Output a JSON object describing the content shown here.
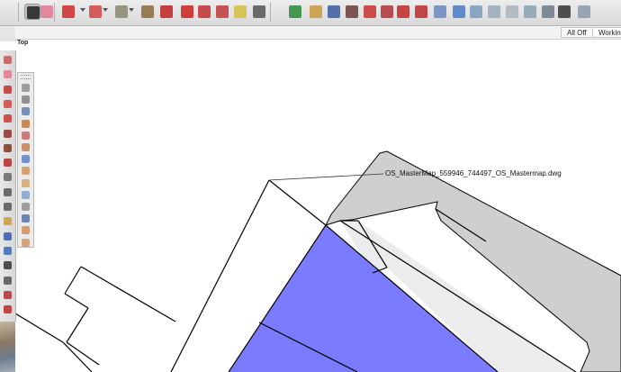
{
  "scene_tabs": [
    {
      "label": "All Off"
    },
    {
      "label": "Working"
    }
  ],
  "viewport": {
    "view_label": "Top",
    "dimension_label": "OS_MasterMap_559946_744497_OS_Mastermap.dwg",
    "colors": {
      "selected_face": "#7b7bff",
      "gray_face": "#cfcfcf",
      "light_face": "#ececec",
      "edge": "#000000"
    }
  },
  "toolbar_tools": [
    {
      "name": "select-tool",
      "icon": "select-arrow-icon",
      "color": "#222222"
    },
    {
      "name": "eraser-tool",
      "icon": "eraser-icon",
      "color": "#e07890"
    },
    {
      "name": "line-tool",
      "icon": "pencil-icon",
      "color": "#cc2a2a"
    },
    {
      "name": "arc-tool",
      "icon": "arc-icon",
      "color": "#d04444"
    },
    {
      "name": "rectangle-tool",
      "icon": "rectangle-icon",
      "color": "#8a8a70"
    },
    {
      "name": "push-pull-tool",
      "icon": "push-pull-icon",
      "color": "#8a6a3a"
    },
    {
      "name": "offset-tool",
      "icon": "offset-icon",
      "color": "#c02020"
    },
    {
      "name": "move-tool",
      "icon": "move-icon",
      "color": "#cc2020"
    },
    {
      "name": "rotate-tool",
      "icon": "rotate-icon",
      "color": "#c03030"
    },
    {
      "name": "scale-tool",
      "icon": "scale-icon",
      "color": "#c03a3a"
    },
    {
      "name": "tape-measure-tool",
      "icon": "tape-measure-icon",
      "color": "#d4c040"
    },
    {
      "name": "text-tool",
      "icon": "text-icon",
      "color": "#555555"
    },
    {
      "name": "orbit-tool",
      "icon": "orbit-icon",
      "color": "#2a8a3a"
    },
    {
      "name": "pan-tool",
      "icon": "pan-hand-icon",
      "color": "#c89a40"
    },
    {
      "name": "zoom-tool",
      "icon": "zoom-magnifier-icon",
      "color": "#3a5aa0"
    },
    {
      "name": "zoom-extents-tool",
      "icon": "zoom-extents-icon",
      "color": "#6a3a3a"
    },
    {
      "name": "components-tool",
      "icon": "components-icon",
      "color": "#c83030"
    },
    {
      "name": "warehouse-tool",
      "icon": "warehouse-icon",
      "color": "#b03030"
    },
    {
      "name": "extension-tool",
      "icon": "extension-icon",
      "color": "#c02828"
    },
    {
      "name": "styles-tool",
      "icon": "styles-icon",
      "color": "#b82a2a"
    },
    {
      "name": "share-tool",
      "icon": "share-icon",
      "color": "#6a8ac0"
    },
    {
      "name": "section-tool",
      "icon": "section-icon",
      "color": "#4a7ac8"
    },
    {
      "name": "style-xray-tool",
      "icon": "xray-cube-icon",
      "color": "#7a9ab8"
    },
    {
      "name": "style-wireframe-tool",
      "icon": "wireframe-cube-icon",
      "color": "#9aaabb"
    },
    {
      "name": "style-hidden-line-tool",
      "icon": "hidden-line-cube-icon",
      "color": "#aab5c0"
    },
    {
      "name": "style-shaded-tool",
      "icon": "shaded-cube-icon",
      "color": "#8aa0b0"
    },
    {
      "name": "style-textured-tool",
      "icon": "textured-cube-icon",
      "color": "#6a7a8a"
    },
    {
      "name": "style-monochrome-tool",
      "icon": "monochrome-cube-icon",
      "color": "#333333"
    },
    {
      "name": "style-extra-tool",
      "icon": "cube-icon",
      "color": "#8a9aaa"
    }
  ],
  "sidebar_tools": [
    {
      "name": "paint-bucket-tool",
      "icon": "paint-bucket-icon",
      "color": "#c05a5a"
    },
    {
      "name": "eraser-tool",
      "icon": "eraser-icon",
      "color": "#e07890"
    },
    {
      "name": "pencil-tool",
      "icon": "pencil-icon",
      "color": "#c03030"
    },
    {
      "name": "arc-tool",
      "icon": "arc-icon",
      "color": "#d04444"
    },
    {
      "name": "freehand-tool",
      "icon": "freehand-icon",
      "color": "#c83838"
    },
    {
      "name": "push-pull-tool",
      "icon": "push-pull-icon",
      "color": "#8a3030"
    },
    {
      "name": "follow-me-tool",
      "icon": "follow-me-icon",
      "color": "#7a3a20"
    },
    {
      "name": "offset-tool",
      "icon": "offset-icon",
      "color": "#b02828"
    },
    {
      "name": "measure-tool",
      "icon": "tape-measure-icon",
      "color": "#666666"
    },
    {
      "name": "text-tool",
      "icon": "text-icon",
      "color": "#555555"
    },
    {
      "name": "paint-tool",
      "icon": "paint-icon",
      "color": "#555555"
    },
    {
      "name": "pan-tool",
      "icon": "pan-hand-icon",
      "color": "#c89a40"
    },
    {
      "name": "zoom-tool",
      "icon": "zoom-magnifier-icon",
      "color": "#3a5aa0"
    },
    {
      "name": "zoom-window-tool",
      "icon": "zoom-window-icon",
      "color": "#3a6ab0"
    },
    {
      "name": "walk-tool",
      "icon": "footprints-icon",
      "color": "#333333"
    },
    {
      "name": "look-around-tool",
      "icon": "eye-icon",
      "color": "#555555"
    },
    {
      "name": "section-plane-tool",
      "icon": "section-plane-icon",
      "color": "#b03030"
    },
    {
      "name": "display-section-tool",
      "icon": "display-section-icon",
      "color": "#c02828"
    }
  ],
  "palette_tools": [
    {
      "name": "dimension-tool",
      "icon": "dimension-icon",
      "color": "#8a8a8a"
    },
    {
      "name": "protractor-tool",
      "icon": "protractor-icon",
      "color": "#7a7a7a"
    },
    {
      "name": "axes-tool",
      "icon": "axes-icon",
      "color": "#5a7ab0"
    },
    {
      "name": "material-tool",
      "icon": "material-icon",
      "color": "#c07030"
    },
    {
      "name": "paint-tool",
      "icon": "paint-icon",
      "color": "#c06060"
    },
    {
      "name": "sandbox-tool",
      "icon": "sandbox-icon",
      "color": "#c07a50"
    },
    {
      "name": "terrain-tool",
      "icon": "terrain-icon",
      "color": "#5a7ac0"
    },
    {
      "name": "stamp-tool",
      "icon": "stamp-icon",
      "color": "#d09050"
    },
    {
      "name": "drape-tool",
      "icon": "drape-icon",
      "color": "#d0a060"
    },
    {
      "name": "smoove-tool",
      "icon": "smoove-icon",
      "color": "#7aa0c8"
    },
    {
      "name": "flip-edge-tool",
      "icon": "flip-edge-icon",
      "color": "#8a8a8a"
    },
    {
      "name": "add-detail-tool",
      "icon": "add-detail-icon",
      "color": "#4a6aa0"
    },
    {
      "name": "grid-tool",
      "icon": "grid-icon",
      "color": "#d08a50"
    },
    {
      "name": "contour-tool",
      "icon": "contour-icon",
      "color": "#d09060"
    }
  ]
}
